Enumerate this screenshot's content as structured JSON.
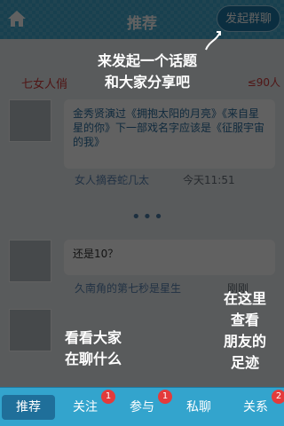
{
  "header": {
    "title": "推荐",
    "start_group_button": "发起群聊"
  },
  "feed": {
    "group": {
      "name": "七女人俏",
      "count": "≤90人"
    },
    "message1": {
      "text": "金秀贤演过《拥抱太阳的月亮》《来自星星的你》下一部戏名字应该是《征服宇宙的我》",
      "author": "女人摘吞蛇几太",
      "time": "今天11:51"
    },
    "more_dots": "•••",
    "message2": {
      "text": "还是10？",
      "author": "久南角的第七秒是星生",
      "time": "刚刚"
    }
  },
  "overlay_tips": {
    "tip1": "来发起一个话题\n和大家分享吧",
    "tip2": "看看大家\n在聊什么",
    "tip3": "在这里\n查看\n朋友的\n足迹"
  },
  "tabs": [
    {
      "label": "推荐",
      "badge": ""
    },
    {
      "label": "关注",
      "badge": "1"
    },
    {
      "label": "参与",
      "badge": "1"
    },
    {
      "label": "私聊",
      "badge": ""
    },
    {
      "label": "关系",
      "badge": "2"
    }
  ]
}
